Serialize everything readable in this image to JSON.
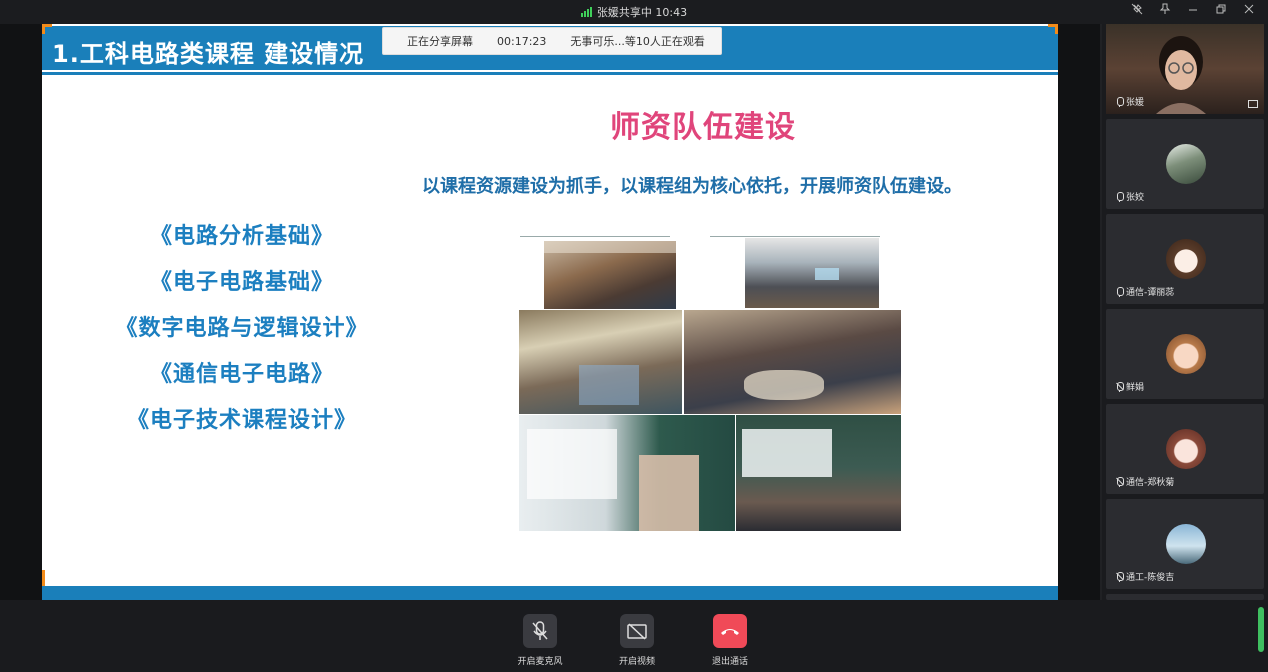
{
  "window": {
    "title": "张媛共享中 10:43",
    "controls": [
      "pin-off-icon",
      "pin-icon",
      "minimize-icon",
      "restore-icon",
      "close-icon"
    ]
  },
  "share_banner": {
    "status": "正在分享屏幕",
    "elapsed": "00:17:23",
    "viewers": "无事可乐...等10人正在观看"
  },
  "slide": {
    "title": "1.工科电路类课程 建设情况",
    "section_title": "师资队伍建设",
    "paragraph": "以课程资源建设为抓手，以课程组为核心依托，开展师资队伍建设。",
    "courses": [
      "《电路分析基础》",
      "《电子电路基础》",
      "《数字电路与逻辑设计》",
      "《通信电子电路》",
      "《电子技术课程设计》"
    ]
  },
  "participants": [
    {
      "name": "张媛",
      "mic": "on",
      "video": true
    },
    {
      "name": "张姣",
      "mic": "on",
      "video": false
    },
    {
      "name": "通信-谭丽蕊",
      "mic": "on",
      "video": false
    },
    {
      "name": "鲜娟",
      "mic": "muted",
      "video": false
    },
    {
      "name": "通信-郑秋菊",
      "mic": "muted",
      "video": false
    },
    {
      "name": "通工-陈俊吉",
      "mic": "muted",
      "video": false
    }
  ],
  "toolbar": {
    "mic_label": "开启麦克风",
    "video_label": "开启视频",
    "leave_label": "退出通话"
  },
  "colors": {
    "accent_blue": "#1a7fba",
    "section_pink": "#e0457b",
    "leave_red": "#f04a58",
    "signal_green": "#3fcf5a"
  }
}
